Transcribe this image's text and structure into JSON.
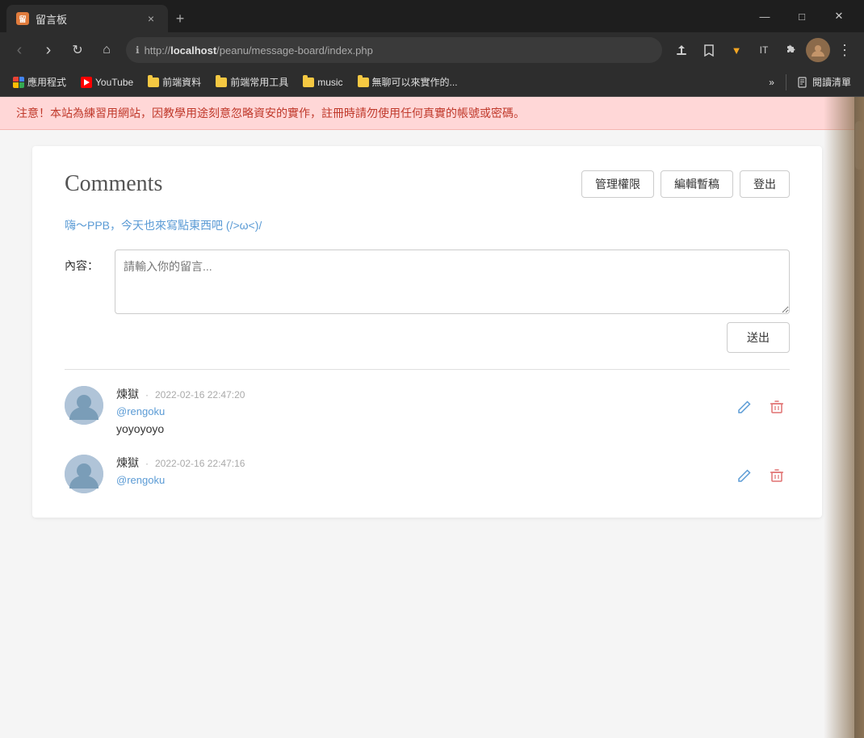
{
  "browser": {
    "tab": {
      "favicon_text": "留",
      "title": "留言板",
      "close_label": "×"
    },
    "new_tab_label": "+",
    "window_controls": {
      "minimize": "—",
      "maximize": "□",
      "close": "✕"
    },
    "nav": {
      "back_label": "‹",
      "forward_label": "›",
      "refresh_label": "↻",
      "home_label": "⌂",
      "url_protocol": "http://",
      "url_host": "localhost",
      "url_path": "/peanu/message-board/index.php",
      "share_label": "⬆",
      "star_label": "☆",
      "v_label": "▼",
      "extensions_label": "🧩",
      "menu_label": "⋮"
    },
    "bookmarks": [
      {
        "type": "grid",
        "label": "應用程式"
      },
      {
        "type": "youtube",
        "label": "YouTube"
      },
      {
        "type": "folder",
        "label": "前端資料"
      },
      {
        "type": "folder",
        "label": "前端常用工具"
      },
      {
        "type": "folder",
        "label": "music"
      },
      {
        "type": "folder",
        "label": "無聊可以來實作的..."
      }
    ],
    "bookmarks_more_label": "»",
    "reading_list_label": "閱讀清單"
  },
  "page": {
    "warning_text": "注意！本站為練習用網站，因教學用途刻意忽略資安的實作，註冊時請勿使用任何真實的帳號或密碼。",
    "title": "Comments",
    "buttons": {
      "admin": "管理權限",
      "edit_draft": "編輯暫稿",
      "logout": "登出"
    },
    "welcome_text": "嗨～PPB，今天也來寫點東西吧 (/>ω<)/",
    "form": {
      "label": "內容：",
      "placeholder": "請輸入你的留言...",
      "submit_label": "送出"
    },
    "comments": [
      {
        "author": "煉獄",
        "timestamp": "2022-02-16 22:47:20",
        "handle": "@rengoku",
        "text": "yoyoyoyo"
      },
      {
        "author": "煉獄",
        "timestamp": "2022-02-16 22:47:16",
        "handle": "@rengoku",
        "text": ""
      }
    ]
  }
}
